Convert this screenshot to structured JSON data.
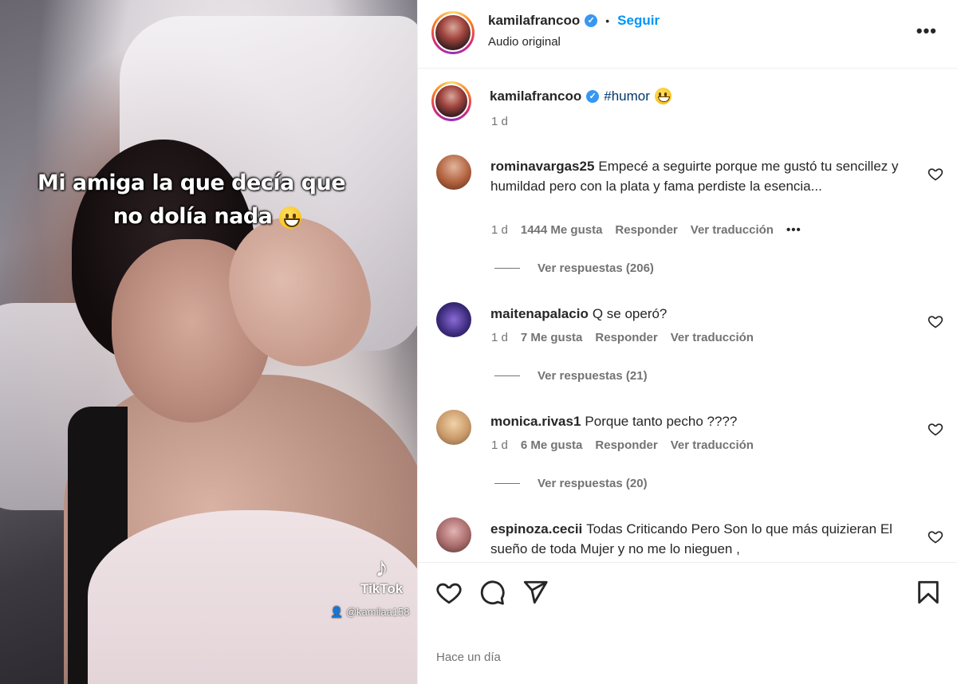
{
  "media": {
    "overlay_line1": "Mi amiga la que decía que",
    "overlay_line2": "no dolía nada",
    "watermark_brand": "TikTok",
    "watermark_user": "@kamilaa158"
  },
  "header": {
    "username": "kamilafrancoo",
    "separator": "•",
    "follow_label": "Seguir",
    "audio_label": "Audio original",
    "more_label": "•••"
  },
  "caption": {
    "username": "kamilafrancoo",
    "hashtag": "#humor",
    "time": "1 d"
  },
  "comments": [
    {
      "username": "rominavargas25",
      "text": "Empecé a seguirte porque me gustó tu sencillez y humildad pero con la plata y fama perdiste la esencia...",
      "time": "1 d",
      "likes": "1444 Me gusta",
      "reply_label": "Responder",
      "translate_label": "Ver traducción",
      "more_label": "•••",
      "replies_label": "Ver respuestas (206)"
    },
    {
      "username": "maitenapalacio",
      "text": "Q se operó?",
      "time": "1 d",
      "likes": "7 Me gusta",
      "reply_label": "Responder",
      "translate_label": "Ver traducción",
      "replies_label": "Ver respuestas (21)"
    },
    {
      "username": "monica.rivas1",
      "text": "Porque tanto pecho ????",
      "time": "1 d",
      "likes": "6 Me gusta",
      "reply_label": "Responder",
      "translate_label": "Ver traducción",
      "replies_label": "Ver respuestas (20)"
    },
    {
      "username": "espinoza.cecii",
      "text": "Todas Criticando Pero Son lo que más quizieran El sueño de toda Mujer y no me lo nieguen ,"
    }
  ],
  "footer": {
    "time": "Hace un día"
  },
  "colors": {
    "accent": "#0095f6",
    "hashtag": "#00376b",
    "verified": "#3897f0",
    "muted": "#737373"
  },
  "icons": [
    "heart-icon",
    "comment-icon",
    "share-icon",
    "bookmark-icon",
    "verified-icon",
    "more-icon"
  ]
}
